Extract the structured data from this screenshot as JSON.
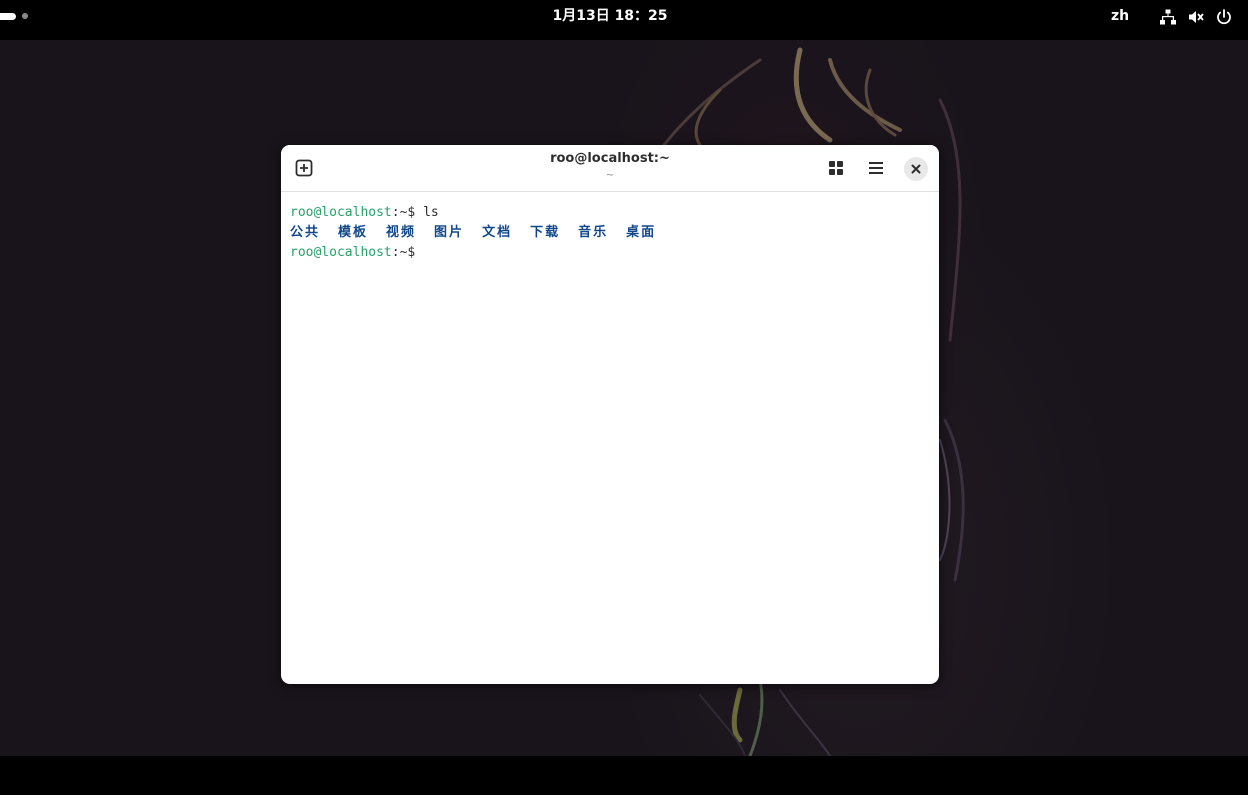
{
  "topbar": {
    "clock": "1月13日 18：25",
    "language": "zh",
    "tray_icons": [
      "network-icon",
      "volume-muted-icon",
      "power-icon"
    ]
  },
  "terminal": {
    "title": "roo@localhost:~",
    "subtitle": "~",
    "lines": [
      {
        "user_host": "roo@localhost",
        "cwd": ":~",
        "prompt": "$ ",
        "command": "ls"
      },
      {
        "user_host": "roo@localhost",
        "cwd": ":~",
        "prompt": "$ ",
        "command": ""
      }
    ],
    "ls_output": [
      "公共",
      "模板",
      "视频",
      "图片",
      "文档",
      "下载",
      "音乐",
      "桌面"
    ]
  },
  "colors": {
    "prompt_user": "#26a269",
    "directory": "#12488b",
    "wallpaper": "#19141b"
  }
}
